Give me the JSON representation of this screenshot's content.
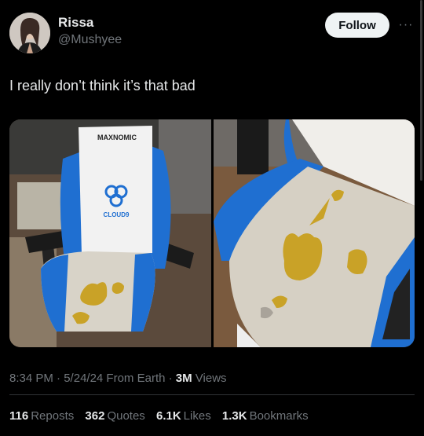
{
  "author": {
    "display_name": "Rissa",
    "handle": "@Mushyee"
  },
  "follow_label": "Follow",
  "more_label": "···",
  "tweet_text": "I really don’t think it’s that bad",
  "media": {
    "chair_brand": "MAXNOMIC",
    "chair_logo_text": "CLOUD9",
    "icons": [
      "avatar",
      "chair-photo-front",
      "chair-photo-closeup",
      "more-icon"
    ]
  },
  "meta": {
    "time": "8:34 PM",
    "sep1": " · ",
    "date": "5/24/24",
    "source": " From Earth",
    "sep2": " · ",
    "views_count": "3M",
    "views_label": " Views"
  },
  "stats": {
    "reposts_count": "116",
    "reposts_label": "Reposts",
    "quotes_count": "362",
    "quotes_label": "Quotes",
    "likes_count": "6.1K",
    "likes_label": "Likes",
    "bookmarks_count": "1.3K",
    "bookmarks_label": "Bookmarks"
  },
  "colors": {
    "background": "#000000",
    "text": "#e7e9ea",
    "muted": "#71767b",
    "chair_blue": "#1f6fd1",
    "chair_white": "#f2f2f2",
    "stain": "#c9a227"
  }
}
